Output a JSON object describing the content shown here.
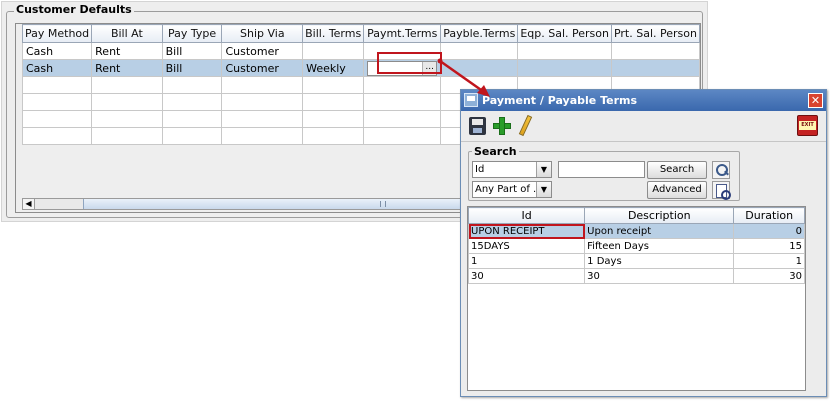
{
  "customer_defaults": {
    "legend": "Customer Defaults",
    "columns": [
      "Pay Method",
      "Bill At",
      "Pay Type",
      "Ship Via",
      "Bill. Terms",
      "Paymt.Terms",
      "Payble.Terms",
      "Eqp. Sal. Person",
      "Prt. Sal. Person"
    ],
    "rows": [
      [
        "Cash",
        "Rent",
        "Bill",
        "Customer",
        "",
        "",
        "",
        "",
        ""
      ],
      [
        "Cash",
        "Rent",
        "Bill",
        "Customer",
        "Weekly",
        "",
        "",
        "",
        ""
      ]
    ],
    "editor_button": "...",
    "scroll_left": "◀"
  },
  "dialog": {
    "title": "Payment / Payable Terms",
    "close": "✕",
    "toolbar": {
      "exit_label": "EXIT",
      "icons": [
        "save-icon",
        "add-icon",
        "edit-icon",
        "exit-icon"
      ]
    },
    "search": {
      "legend": "Search",
      "field_value": "Id",
      "match_value": "Any Part of ...",
      "query_value": "",
      "search_button": "Search",
      "advanced_button": "Advanced",
      "dropdown_arrow": "▼"
    },
    "results": {
      "columns": [
        "Id",
        "Description",
        "Duration"
      ],
      "rows": [
        [
          "UPON RECEIPT",
          "Upon receipt",
          "0"
        ],
        [
          "15DAYS",
          "Fifteen Days",
          "15"
        ],
        [
          "1",
          "1 Days",
          "1"
        ],
        [
          "30",
          "30",
          "30"
        ]
      ]
    }
  },
  "colors": {
    "title_bar": "#3a68ad",
    "selected_row": "#b8cfe5",
    "highlight": "#c0151d"
  }
}
